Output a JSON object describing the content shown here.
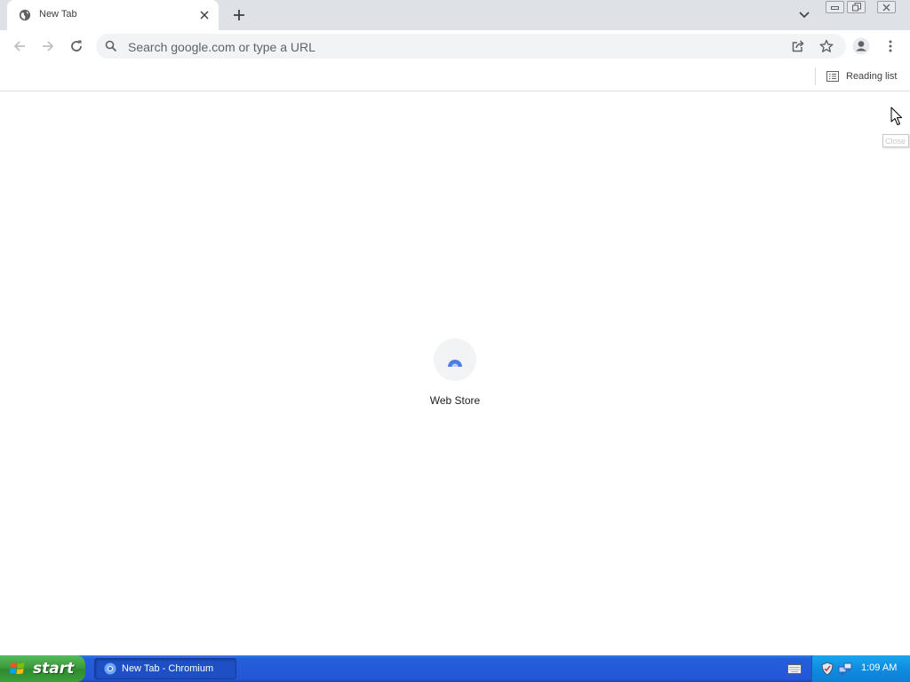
{
  "browser": {
    "tab": {
      "title": "New Tab",
      "favicon": "globe-icon"
    },
    "omnibox": {
      "placeholder": "Search google.com or type a URL"
    },
    "bookmark_bar": {
      "reading_list_label": "Reading list"
    }
  },
  "content": {
    "shortcuts": [
      {
        "label": "Web Store",
        "icon": "web-store-icon"
      }
    ],
    "tooltip": "Close"
  },
  "taskbar": {
    "start_label": "start",
    "items": [
      {
        "label": "New Tab - Chromium"
      }
    ],
    "clock": "1:09 AM"
  },
  "colors": {
    "tabstrip_bg": "#dee1e6",
    "omnibox_bg": "#f1f3f4",
    "taskbar_blue": "#245edb",
    "start_green": "#3b9b3b",
    "tray_blue": "#0f8ce0"
  }
}
